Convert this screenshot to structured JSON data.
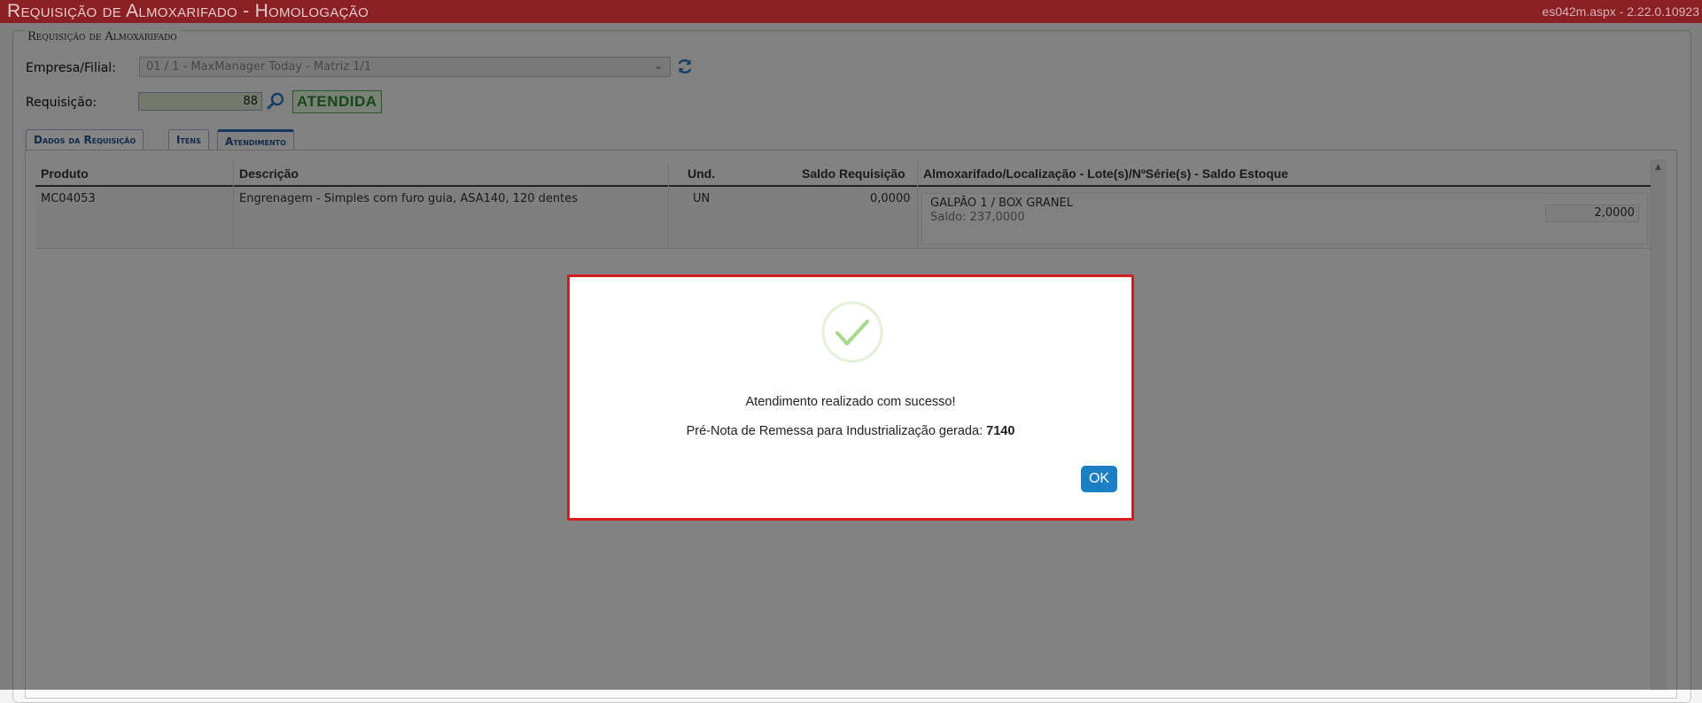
{
  "window": {
    "title": "Requisição de Almoxarifado  - Homologação",
    "version": "es042m.aspx - 2.22.0.10923"
  },
  "form": {
    "legend": "Requisição de Almoxarifado",
    "empresa_label": "Empresa/Filial:",
    "empresa_value": "01 / 1 - MaxManager Today - Matriz 1/1",
    "requisicao_label": "Requisição:",
    "requisicao_value": "88",
    "status": "ATENDIDA"
  },
  "tabs": [
    {
      "label": "Dados da Requisição",
      "active": false
    },
    {
      "label": "Itens",
      "active": false
    },
    {
      "label": "Atendimento",
      "active": true
    }
  ],
  "grid": {
    "headers": [
      "Produto",
      "Descrição",
      "Und.",
      "Saldo Requisição",
      "Almoxarifado/Localização - Lote(s)/NºSérie(s) - Saldo Estoque"
    ],
    "rows": [
      {
        "produto": "MC04053",
        "descricao": "Engrenagem - Simples com furo guia, ASA140, 120 dentes",
        "und": "UN",
        "saldo": "0,0000",
        "local": "GALPÃO 1 / BOX GRANEL",
        "saldo_estoque": "Saldo: 237,0000",
        "quantidade": "2,0000"
      }
    ]
  },
  "modal": {
    "message": "Atendimento realizado com sucesso!",
    "detail_prefix": "Pré-Nota de Remessa para Industrialização gerada: ",
    "detail_number": "7140",
    "ok_label": "OK"
  },
  "colors": {
    "title_bar": "#8a1f24",
    "modal_border": "#d61d1d",
    "ok_button": "#1b7fc6",
    "status_green": "#2e8a2e"
  }
}
